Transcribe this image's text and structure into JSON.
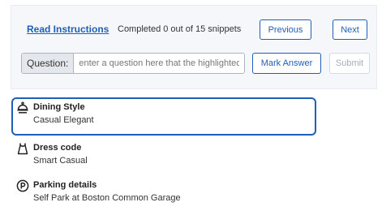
{
  "toolbar": {
    "instructions_link": "Read Instructions",
    "status_text": "Completed 0 out of 15 snippets",
    "previous_label": "Previous",
    "next_label": "Next",
    "question_label": "Question:",
    "question_placeholder": "enter a question here that the highlighted snippet answers",
    "question_value": "",
    "mark_answer_label": "Mark Answer",
    "submit_label": "Submit"
  },
  "details": [
    {
      "icon": "dining-bell-icon",
      "title": "Dining Style",
      "value": "Casual Elegant",
      "highlighted": true
    },
    {
      "icon": "dress-icon",
      "title": "Dress code",
      "value": "Smart Casual",
      "highlighted": false
    },
    {
      "icon": "parking-icon",
      "title": "Parking details",
      "value": "Self Park at Boston Common Garage",
      "highlighted": false
    }
  ],
  "colors": {
    "accent": "#1f5fb8",
    "panel_background": "#f5f7fb",
    "disabled": "#a8adb5"
  }
}
